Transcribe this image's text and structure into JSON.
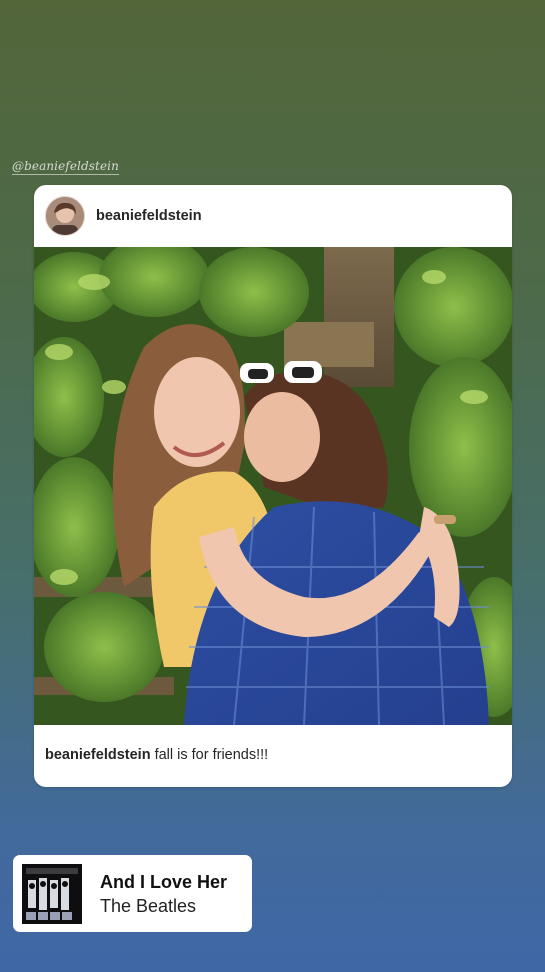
{
  "story": {
    "mention": "@beaniefeldstein"
  },
  "post": {
    "username": "beaniefeldstein",
    "caption_user": "beaniefeldstein",
    "caption_text": " fall is for friends!!!",
    "avatar_icon": "profile-avatar",
    "photo_alt": "two friends hugging"
  },
  "music": {
    "title": "And I Love Her",
    "artist": "The Beatles",
    "album_icon": "album-cover"
  },
  "colors": {
    "background_top": "#53663a",
    "background_bottom": "#3f67a6",
    "card": "#ffffff",
    "text": "#262626"
  }
}
